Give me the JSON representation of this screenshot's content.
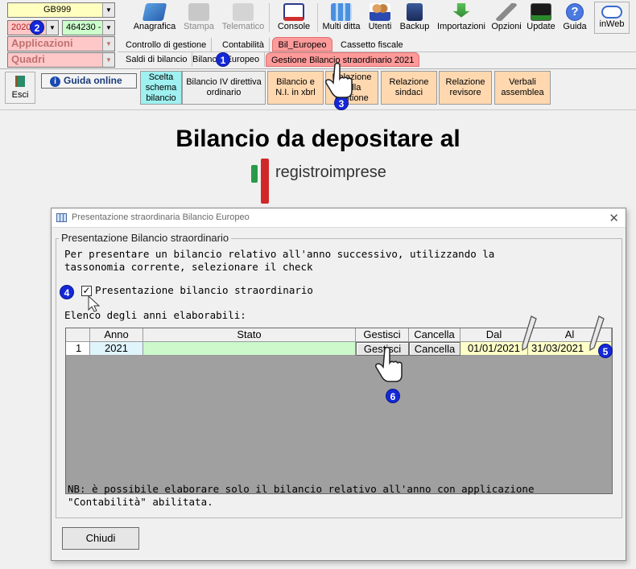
{
  "header": {
    "code_combo": "GB999",
    "year_combo": "2020",
    "company_combo": "464230 -",
    "applicazioni_label": "Applicazioni",
    "quadri_label": "Quadri"
  },
  "toolbar": [
    {
      "label": "Anagrafica",
      "icon": "address-book-icon",
      "enabled": true
    },
    {
      "label": "Stampa",
      "icon": "printer-icon",
      "enabled": false
    },
    {
      "label": "Telematico",
      "icon": "telematic-icon",
      "enabled": false
    },
    {
      "label": "Console",
      "icon": "console-icon",
      "enabled": true
    },
    {
      "label": "Multi ditta",
      "icon": "multi-company-icon",
      "enabled": true
    },
    {
      "label": "Utenti",
      "icon": "users-icon",
      "enabled": true
    },
    {
      "label": "Backup",
      "icon": "backup-icon",
      "enabled": true
    },
    {
      "label": "Importazioni",
      "icon": "import-icon",
      "enabled": true
    },
    {
      "label": "Opzioni",
      "icon": "wrench-icon",
      "enabled": true
    },
    {
      "label": "Update",
      "icon": "update-icon",
      "enabled": true
    },
    {
      "label": "Guida",
      "icon": "help-icon",
      "enabled": true
    },
    {
      "label": "inWeb",
      "icon": "cloud-icon",
      "enabled": true
    }
  ],
  "menu_row1": [
    "Controllo di gestione",
    "Contabilità",
    "Bil_Europeo",
    "Cassetto fiscale"
  ],
  "menu_row2": [
    "Saldi di bilancio",
    "Bilancio Europeo",
    "Gestione Bilancio straordinario 2021"
  ],
  "subbar": {
    "esci": "Esci",
    "guida_online": "Guida online",
    "buttons": [
      {
        "label": "Scelta schema bilancio"
      },
      {
        "label": "Bilancio IV direttiva ordinario"
      },
      {
        "label": "Bilancio e N.I. in xbrl"
      },
      {
        "label": "Relazione sulla gestione"
      },
      {
        "label": "Relazione sindaci"
      },
      {
        "label": "Relazione revisore"
      },
      {
        "label": "Verbali assemblea"
      }
    ]
  },
  "main": {
    "title": "Bilancio da depositare al",
    "logo_text": "registroimprese"
  },
  "badges": [
    "1",
    "2",
    "3",
    "4",
    "5",
    "6"
  ],
  "dialog": {
    "title": "Presentazione straordinaria Bilancio Europeo",
    "group_title": "Presentazione Bilancio straordinario",
    "description_line1": "Per presentare un bilancio relativo all'anno successivo, utilizzando la",
    "description_line2": "tassonomia corrente, selezionare il check",
    "checkbox_label": "Presentazione bilancio straordinario",
    "checkbox_checked": true,
    "list_label": "Elenco degli anni elaborabili:",
    "columns": [
      "",
      "Anno",
      "Stato",
      "Gestisci",
      "Cancella",
      "Dal",
      "Al"
    ],
    "rows": [
      {
        "num": "1",
        "anno": "2021",
        "stato": "",
        "gestisci": "Gestisci",
        "cancella": "Cancella",
        "dal": "01/01/2021",
        "al": "31/03/2021"
      }
    ],
    "note_line1": "NB: è possibile elaborare solo il bilancio relativo all'anno con applicazione",
    "note_line2": "\"Contabilità\" abilitata.",
    "close_button": "Chiudi"
  }
}
